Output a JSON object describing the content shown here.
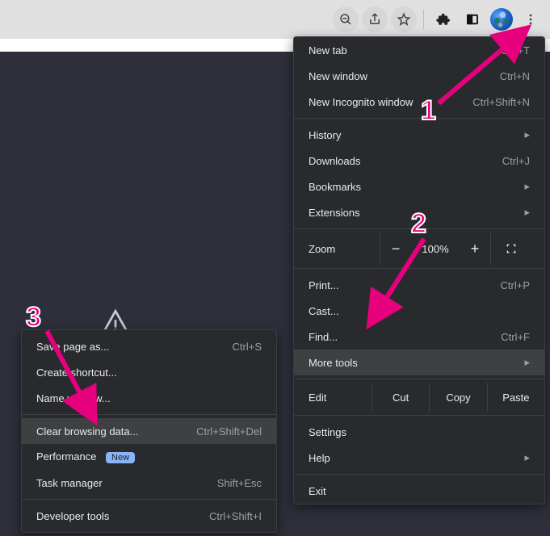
{
  "toolbar": {
    "icons": {
      "zoom_out": "zoom-out-icon",
      "share": "share-icon",
      "star": "star-icon",
      "extensions": "puzzle-icon",
      "sidepanel": "sidepanel-icon",
      "avatar": "profile-avatar",
      "menu": "kebab-menu-icon"
    }
  },
  "menu": {
    "new_tab": {
      "label": "New tab",
      "shortcut": "Ctrl+T"
    },
    "new_window": {
      "label": "New window",
      "shortcut": "Ctrl+N"
    },
    "incognito": {
      "label": "New Incognito window",
      "shortcut": "Ctrl+Shift+N"
    },
    "history": {
      "label": "History"
    },
    "downloads": {
      "label": "Downloads",
      "shortcut": "Ctrl+J"
    },
    "bookmarks": {
      "label": "Bookmarks"
    },
    "extensions": {
      "label": "Extensions"
    },
    "zoom": {
      "label": "Zoom",
      "value": "100%",
      "minus": "−",
      "plus": "+"
    },
    "print": {
      "label": "Print...",
      "shortcut": "Ctrl+P"
    },
    "cast": {
      "label": "Cast..."
    },
    "find": {
      "label": "Find...",
      "shortcut": "Ctrl+F"
    },
    "more_tools": {
      "label": "More tools"
    },
    "edit": {
      "label": "Edit",
      "cut": "Cut",
      "copy": "Copy",
      "paste": "Paste"
    },
    "settings": {
      "label": "Settings"
    },
    "help": {
      "label": "Help"
    },
    "exit": {
      "label": "Exit"
    }
  },
  "submenu": {
    "save_as": {
      "label": "Save page as...",
      "shortcut": "Ctrl+S"
    },
    "shortcut": {
      "label": "Create shortcut..."
    },
    "name_window": {
      "label": "Name window..."
    },
    "clear_data": {
      "label": "Clear browsing data...",
      "shortcut": "Ctrl+Shift+Del"
    },
    "performance": {
      "label": "Performance",
      "badge": "New"
    },
    "task_manager": {
      "label": "Task manager",
      "shortcut": "Shift+Esc"
    },
    "dev_tools": {
      "label": "Developer tools",
      "shortcut": "Ctrl+Shift+I"
    }
  },
  "annotations": {
    "n1": "1",
    "n2": "2",
    "n3": "3"
  }
}
